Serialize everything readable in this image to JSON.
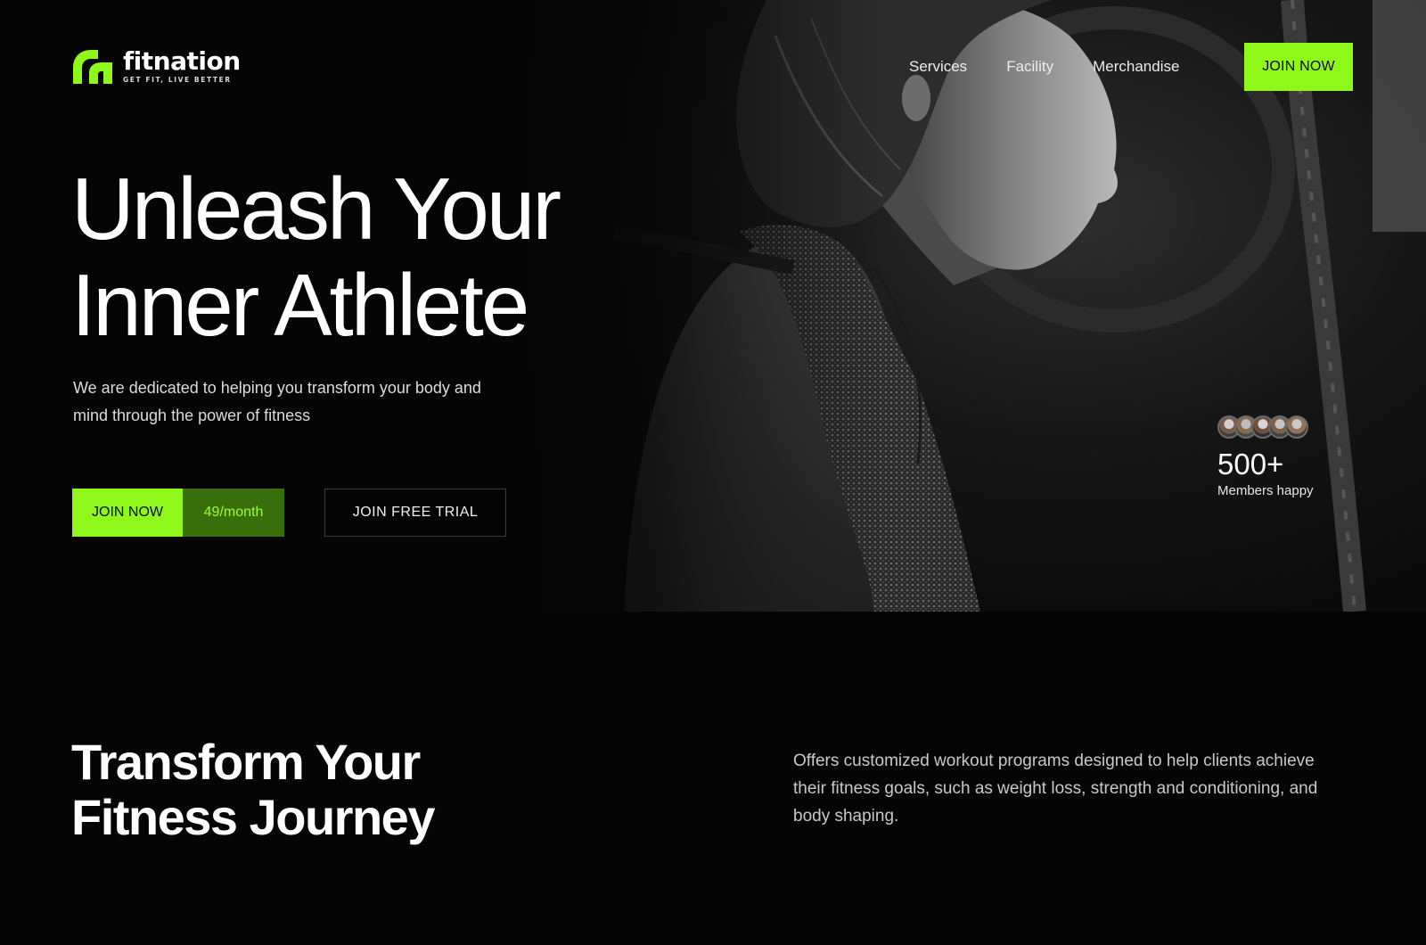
{
  "brand": {
    "name": "fitnation",
    "tagline": "GET FIT, LIVE BETTER",
    "accent_color": "#8ff81a"
  },
  "nav": {
    "items": [
      {
        "label": "Services"
      },
      {
        "label": "Facility"
      },
      {
        "label": "Merchandise"
      }
    ],
    "cta_label": "JOIN NOW"
  },
  "hero": {
    "headline_line1": "Unleash Your",
    "headline_line2": "Inner Athlete",
    "subtext": "We are dedicated to helping you transform your body and mind through the power of fitness",
    "join_label": "JOIN NOW",
    "price_label": "49/month",
    "trial_label": "JOIN FREE TRIAL"
  },
  "members": {
    "count": "500+",
    "label": "Members happy",
    "avatar_count": 5
  },
  "section2": {
    "title_line1": "Transform Your",
    "title_line2": "Fitness Journey",
    "body": "Offers customized workout programs designed to help clients achieve their fitness goals, such as weight loss, strength and conditioning, and body shaping."
  }
}
